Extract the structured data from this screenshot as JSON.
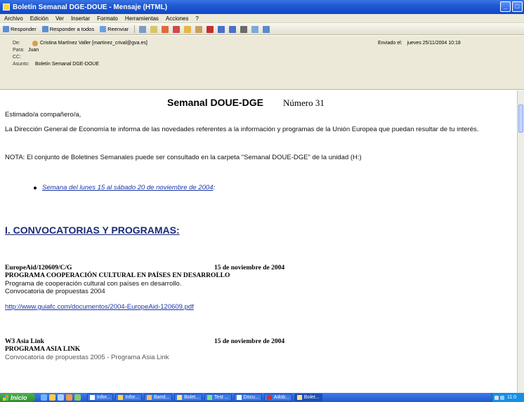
{
  "window": {
    "title": "Boletín Semanal DGE-DOUE - Mensaje (HTML)",
    "controls": [
      "_",
      "□"
    ]
  },
  "menu": [
    "Archivo",
    "Edición",
    "Ver",
    "Insertar",
    "Formato",
    "Herramientas",
    "Acciones",
    "?"
  ],
  "toolbar": {
    "reply": "Responder",
    "reply_all": "Responder a todos",
    "forward": "Reenviar"
  },
  "header": {
    "from_label": "De:",
    "from_value": "Cristina Martínez Valler [martinez_crival@gva.es]",
    "to_label": "Para:",
    "to_value": "Juan",
    "cc_label": "CC:",
    "cc_value": "",
    "subject_label": "Asunto:",
    "subject_value": "Boletín Semanal DGE-DOUE",
    "sent_label": "Enviado el:",
    "sent_value": "jueves 25/11/2004 10:18"
  },
  "message": {
    "heading": "Semanal DOUE-DGE",
    "number": "Número 31",
    "greeting": "Estimado/a compañero/a,",
    "intro": "La Dirección General de Economía te informa de las novedades referentes a la información y programas de la Unión Europea que puedan resultar de tu interés.",
    "note": "NOTA: El conjunto de Boletines Semanales puede ser consultado en la carpeta \"Semanal DOUE-DGE\" de la unidad (H:)",
    "week_link": "Semana del lunes 15 al sábado 20 de noviembre de 2004",
    "week_after": ":",
    "section1": "I. CONVOCATORIAS Y PROGRAMAS:",
    "item1": {
      "ref": "EuropeAid/120609/C/G",
      "date": "15 de noviembre de 2004",
      "title": "PROGRAMA COOPERACIÓN CULTURAL EN PAÍSES EN DESARROLLO",
      "desc": "Programa de cooperación cultural con países en desarrollo.",
      "desc2": "Convocatoria de propuestas 2004",
      "link": "http://www.guiafc.com/documentos/2004-EuropeAid-120609.pdf"
    },
    "item2": {
      "ref": "W3 Asia Link",
      "date": "15 de noviembre de 2004",
      "title": "PROGRAMA ASIA LINK",
      "desc": "Convocatoria de propuestas 2005 - Programa Asia Link"
    }
  },
  "taskbar": {
    "start": "Inicio",
    "tasks": [
      "Infor...",
      "Infor...",
      "Band...",
      "Bolet...",
      "Test ...",
      "Docu...",
      "Adob...",
      "Bolet..."
    ],
    "clock": "11:0"
  },
  "colors": {
    "titlebar": "#0f48c4",
    "link": "#1a35a8",
    "chrome": "#ece9d8"
  }
}
